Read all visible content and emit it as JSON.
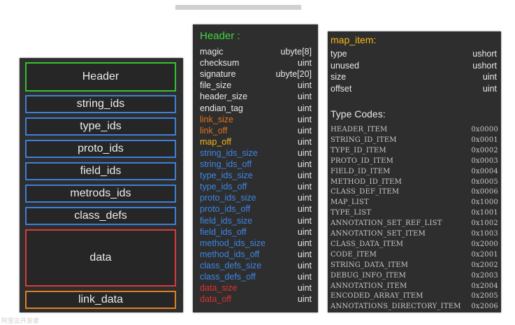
{
  "dex_layout": {
    "blocks": [
      {
        "label": "Header",
        "color": "#33c233"
      },
      {
        "label": "string_ids",
        "color": "#3d7fd9"
      },
      {
        "label": "type_ids",
        "color": "#3d7fd9"
      },
      {
        "label": "proto_ids",
        "color": "#3d7fd9"
      },
      {
        "label": "field_ids",
        "color": "#3d7fd9"
      },
      {
        "label": "metrods_ids",
        "color": "#3d7fd9"
      },
      {
        "label": "class_defs",
        "color": "#3d7fd9"
      },
      {
        "label": "data",
        "color": "#d93b3b"
      },
      {
        "label": "link_data",
        "color": "#e07f22"
      }
    ]
  },
  "header_panel": {
    "title": "Header :",
    "fields": [
      {
        "name": "magic",
        "type": "ubyte[8]",
        "color": "white"
      },
      {
        "name": "checksum",
        "type": "uint",
        "color": "white"
      },
      {
        "name": "signature",
        "type": "ubyte[20]",
        "color": "white"
      },
      {
        "name": "file_size",
        "type": "uint",
        "color": "white"
      },
      {
        "name": "header_size",
        "type": "uint",
        "color": "white"
      },
      {
        "name": "endian_tag",
        "type": "uint",
        "color": "white"
      },
      {
        "name": "link_size",
        "type": "uint",
        "color": "orange"
      },
      {
        "name": "link_off",
        "type": "uint",
        "color": "orange"
      },
      {
        "name": "map_off",
        "type": "uint",
        "color": "yellow"
      },
      {
        "name": "string_ids_size",
        "type": "uint",
        "color": "blue"
      },
      {
        "name": "string_ids_off",
        "type": "uint",
        "color": "blue"
      },
      {
        "name": "type_ids_size",
        "type": "uint",
        "color": "blue"
      },
      {
        "name": "type_ids_off",
        "type": "uint",
        "color": "blue"
      },
      {
        "name": "proto_ids_size",
        "type": "uint",
        "color": "blue"
      },
      {
        "name": "proto_ids_off",
        "type": "uint",
        "color": "blue"
      },
      {
        "name": "field_ids_size",
        "type": "uint",
        "color": "blue"
      },
      {
        "name": "field_ids_off",
        "type": "uint",
        "color": "blue"
      },
      {
        "name": "method_ids_size",
        "type": "uint",
        "color": "blue"
      },
      {
        "name": "method_ids_off",
        "type": "uint",
        "color": "blue"
      },
      {
        "name": "class_defs_size",
        "type": "uint",
        "color": "blue"
      },
      {
        "name": "class_defs_off",
        "type": "uint",
        "color": "blue"
      },
      {
        "name": "data_size",
        "type": "uint",
        "color": "red"
      },
      {
        "name": "data_off",
        "type": "uint",
        "color": "red"
      }
    ]
  },
  "map_item_panel": {
    "title": "map_item:",
    "fields": [
      {
        "name": "type",
        "type": "ushort"
      },
      {
        "name": "unused",
        "type": "ushort"
      },
      {
        "name": "size",
        "type": "uint"
      },
      {
        "name": "offset",
        "type": "uint"
      }
    ],
    "type_codes_heading": "Type Codes:",
    "type_codes": [
      {
        "name": "HEADER_ITEM",
        "code": "0x0000"
      },
      {
        "name": "STRING_ID_ITEM",
        "code": "0x0001"
      },
      {
        "name": "TYPE_ID_ITEM",
        "code": "0x0002"
      },
      {
        "name": "PROTO_ID_ITEM",
        "code": "0x0003"
      },
      {
        "name": "FIELD_ID_ITEM",
        "code": "0x0004"
      },
      {
        "name": "METHOD_ID_ITEM",
        "code": "0x0005"
      },
      {
        "name": "CLASS_DEF_ITEM",
        "code": "0x0006"
      },
      {
        "name": "MAP_LIST",
        "code": "0x1000"
      },
      {
        "name": "TYPE_LIST",
        "code": "0x1001"
      },
      {
        "name": "ANNOTATION_SET_REF_LIST",
        "code": "0x1002"
      },
      {
        "name": "ANNOTATION_SET_ITEM",
        "code": "0x1003"
      },
      {
        "name": "CLASS_DATA_ITEM",
        "code": "0x2000"
      },
      {
        "name": "CODE_ITEM",
        "code": "0x2001"
      },
      {
        "name": "STRING_DATA_ITEM",
        "code": "0x2002"
      },
      {
        "name": "DEBUG_INFO_ITEM",
        "code": "0x2003"
      },
      {
        "name": "ANNOTATION_ITEM",
        "code": "0x2004"
      },
      {
        "name": "ENCODED_ARRAY_ITEM",
        "code": "0x2005"
      },
      {
        "name": "ANNOTATIONS_DIRECTORY_ITEM",
        "code": "0x2006"
      }
    ]
  },
  "watermark": "阿里云开发者"
}
